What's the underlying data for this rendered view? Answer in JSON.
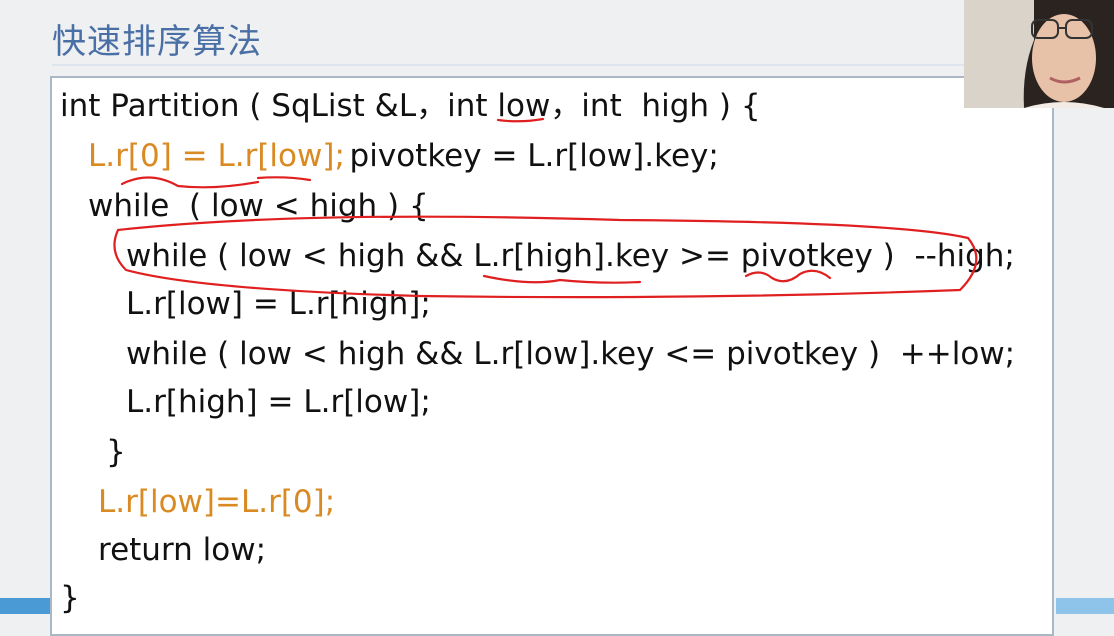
{
  "slide": {
    "title": "快速排序算法"
  },
  "code": {
    "lines": [
      "int Partition ( SqList &L，int low，int  high ) {",
      "L.r[0] = L.r[low];",
      "   pivotkey = L.r[low].key;",
      "while  ( low < high ) {",
      "while ( low < high && L.r[high].key >= pivotkey )  --high;",
      "L.r[low] = L.r[high];",
      "while ( low < high && L.r[low].key <= pivotkey )  ++low;",
      "L.r[high] = L.r[low];",
      "}",
      "L.r[low]=L.r[0];",
      "return low;",
      "}"
    ]
  },
  "colors": {
    "title": "#4a6fa5",
    "highlight": "#d98a22",
    "annotation": "#e02020"
  },
  "webcam": {
    "icon": "presenter-video-icon"
  }
}
